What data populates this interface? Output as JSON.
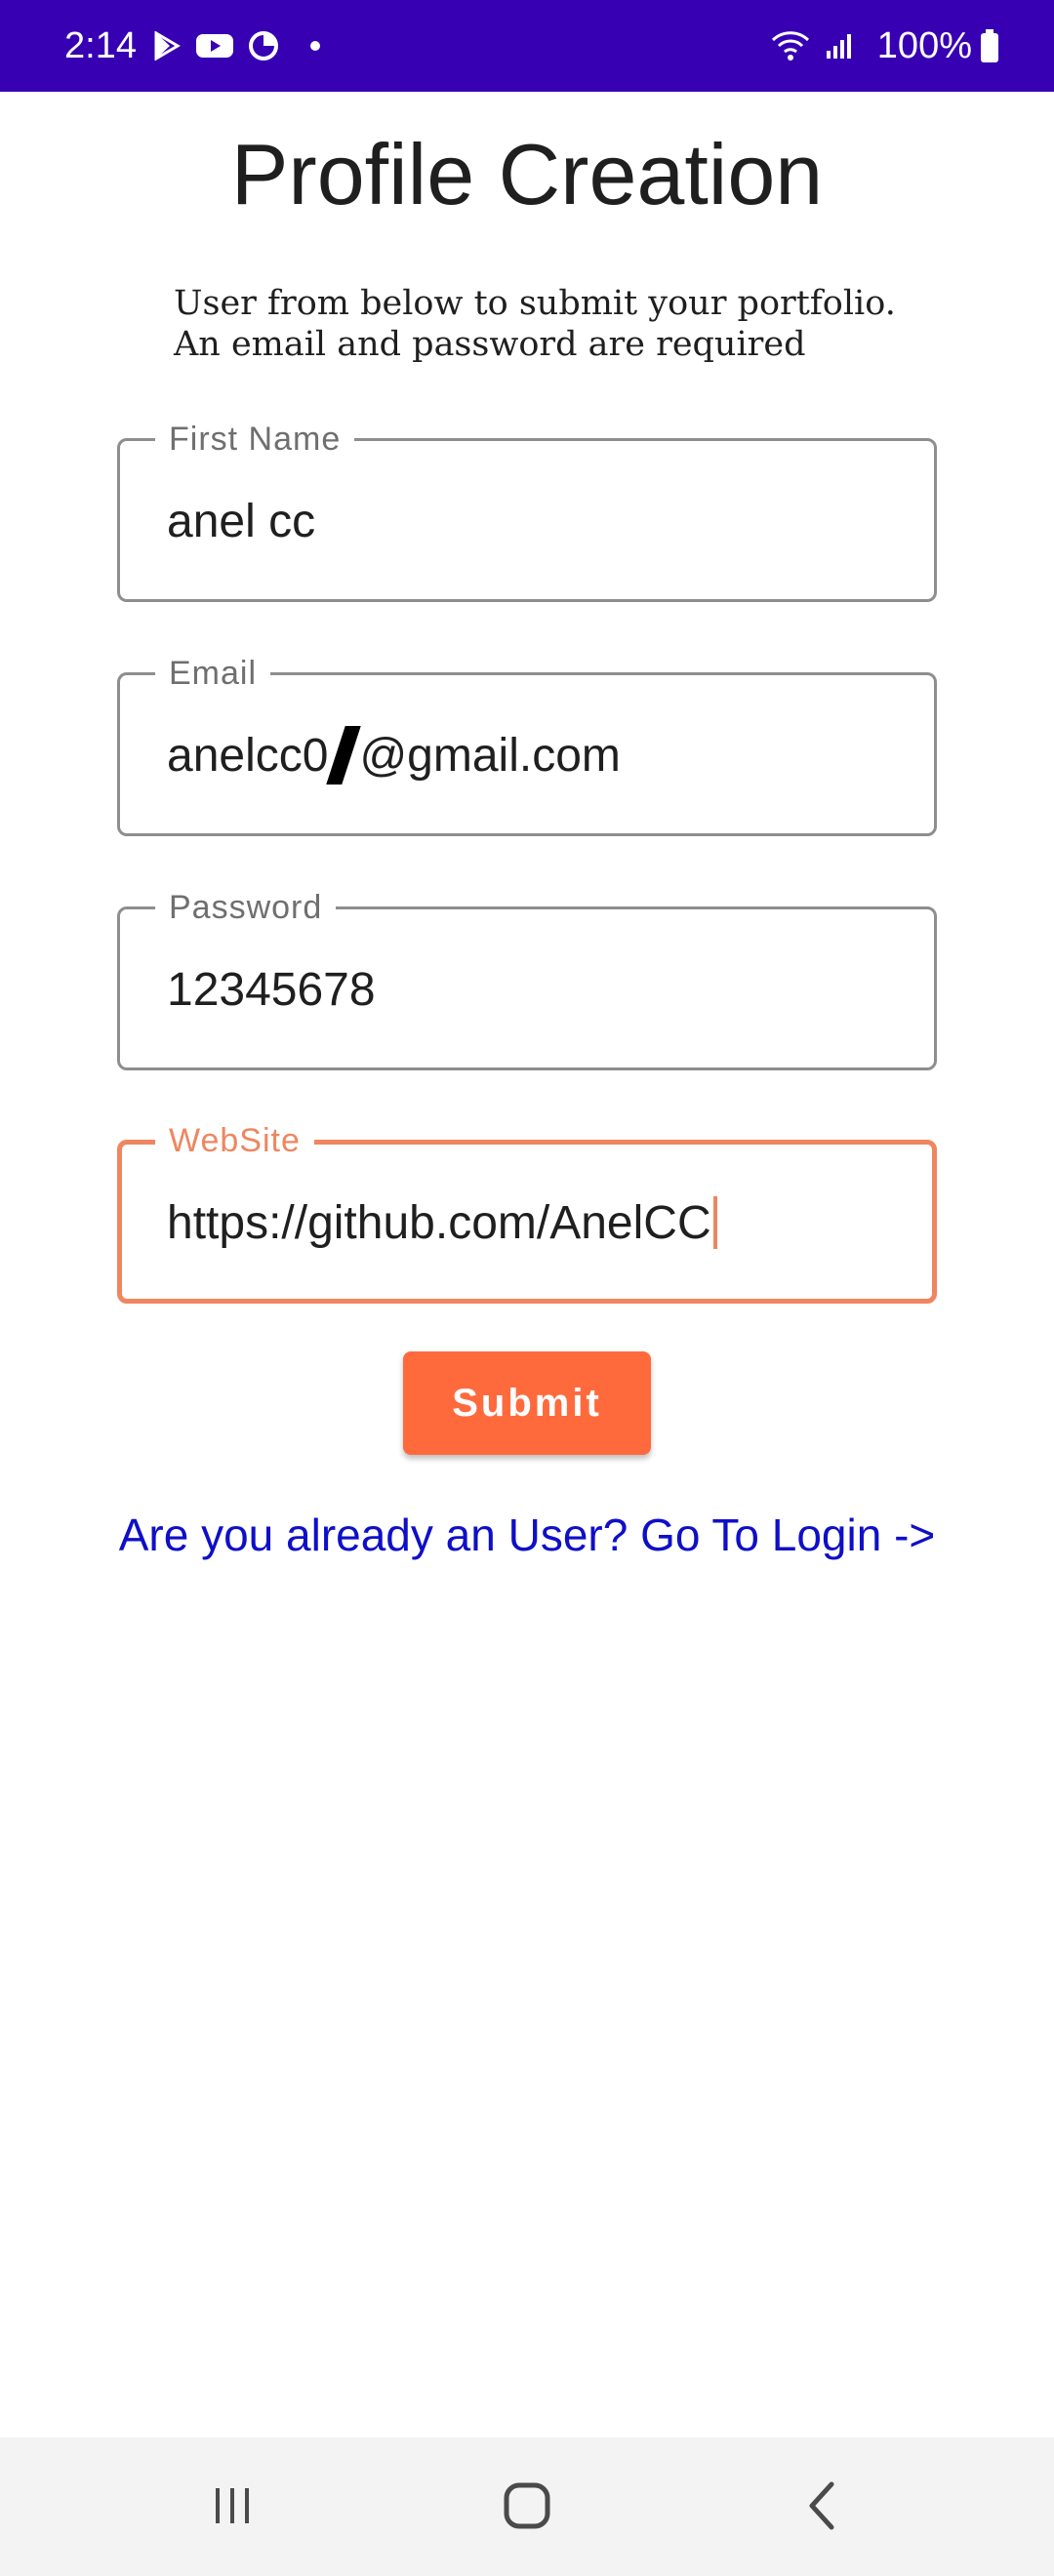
{
  "status_bar": {
    "time": "2:14",
    "battery": "100%",
    "icons": [
      "play-store-icon",
      "youtube-icon",
      "data-saver-icon",
      "notification-dot-icon",
      "wifi-icon",
      "signal-icon",
      "battery-icon"
    ]
  },
  "header": {
    "title": "Profile Creation",
    "subtitle_line1": "User from below to submit your portfolio.",
    "subtitle_line2": "An email and password are required"
  },
  "form": {
    "first_name": {
      "label": "First Name",
      "value": "anel cc"
    },
    "email": {
      "label": "Email",
      "value_prefix": "anelcc0",
      "value_suffix": "@gmail.com"
    },
    "password": {
      "label": "Password",
      "value": "12345678"
    },
    "website": {
      "label": "WebSite",
      "value": "https://github.com/AnelCC"
    },
    "submit_label": "Submit",
    "login_link": "Are you already an User? Go To Login ->"
  },
  "nav_bar": {
    "icons": [
      "recent-apps-icon",
      "home-icon",
      "back-icon"
    ]
  },
  "colors": {
    "status_bar": "#3700b3",
    "accent": "#ef8660",
    "button": "#ff6a3d",
    "link": "#0f0fc8"
  }
}
